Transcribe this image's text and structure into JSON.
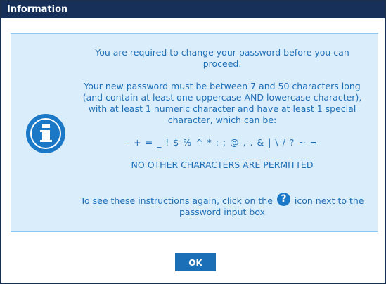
{
  "dialog": {
    "title": "Information",
    "message_1": "You are required to change your password before you can proceed.",
    "message_2": "Your new password must be between 7 and 50 characters long (and contain at least one uppercase AND lowercase character), with at least 1 numeric character and have at least 1 special character, which can be:",
    "special_characters": "- + = _ ! $ % ^ * : ; @ , . & | \\ / ? ~ ¬",
    "restriction": "NO OTHER CHARACTERS ARE PERMITTED",
    "help_prefix": "To see these instructions again, click on the",
    "help_icon": "?",
    "help_suffix": "icon next to the password input box",
    "ok_label": "OK"
  },
  "icons": {
    "info_icon": "info-circle",
    "help_icon": "question-circle"
  },
  "colors": {
    "titlebar": "#17305a",
    "panel_background": "#d9edfb",
    "panel_border": "#8fc7ee",
    "accent": "#1a78c6",
    "text": "#1f6fb7",
    "button": "#1a6fb7"
  }
}
